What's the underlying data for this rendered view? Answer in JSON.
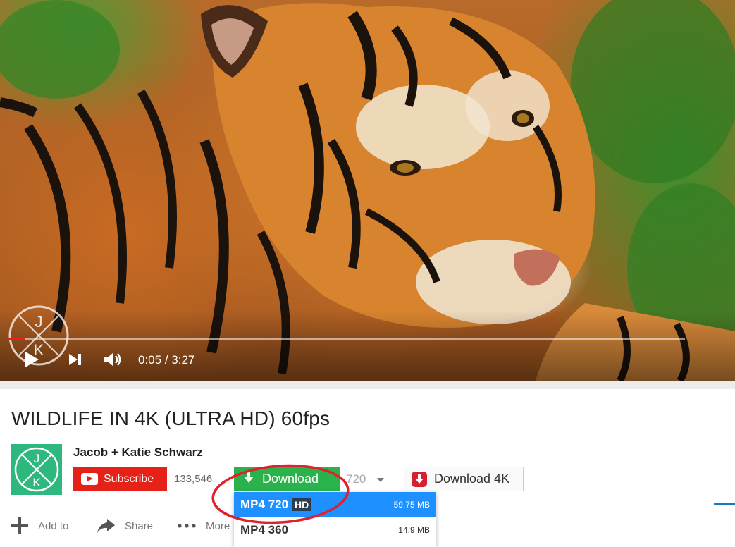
{
  "player": {
    "time_current": "0:05",
    "time_separator": " / ",
    "time_total": "3:27",
    "progress_fraction": 0.025
  },
  "video": {
    "title": "WILDLIFE IN 4K (ULTRA HD) 60fps",
    "channel": "Jacob + Katie Schwarz"
  },
  "buttons": {
    "subscribe_label": "Subscribe",
    "subscriber_count": "133,546",
    "download_label": "Download",
    "quality_selected": "720",
    "download_4k_label": "Download 4K"
  },
  "actions": {
    "add_to": "Add to",
    "share": "Share",
    "more": "More"
  },
  "download_menu": {
    "items": [
      {
        "format": "MP4 720",
        "badge": "HD",
        "size": "59.75 MB",
        "selected": true
      },
      {
        "format": "MP4 360",
        "badge": "",
        "size": "14.9 MB",
        "selected": false
      }
    ]
  },
  "watermark_letters": [
    "J",
    "K"
  ],
  "colors": {
    "subscribe_red": "#e62117",
    "download_green": "#2ab24c",
    "menu_highlight": "#1e90ff",
    "annotation_red": "#e0202a",
    "avatar_green": "#2fb87e"
  }
}
